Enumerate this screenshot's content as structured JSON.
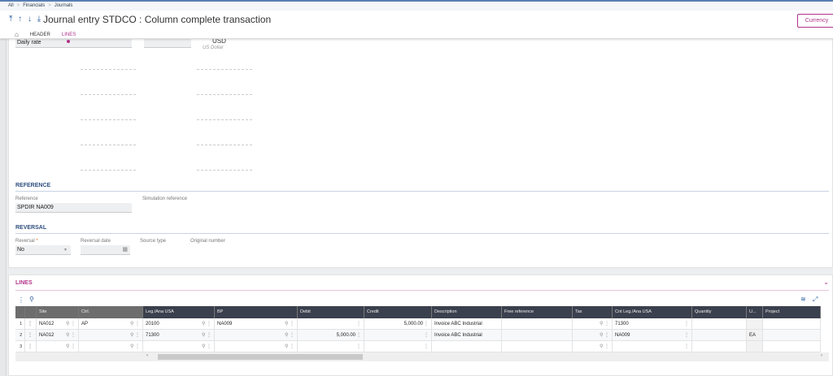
{
  "breadcrumb": [
    "All",
    "Financials",
    "Journals"
  ],
  "header": {
    "title": "Journal entry STDCO : Column complete transaction",
    "nav_icons": "⤒ ↑ ↓ ⤓",
    "tabs": [
      "HEADER",
      "LINES"
    ],
    "active_tab": "LINES",
    "currency_button": "Currency"
  },
  "partial_fields": {
    "rate_type": "Daily rate",
    "currency": "USD",
    "currency_name": "US Dollar"
  },
  "reference": {
    "section": "REFERENCE",
    "reference_label": "Reference",
    "reference_value": "SPDIR NA009",
    "simulation_label": "Simulation reference"
  },
  "reversal": {
    "section": "REVERSAL",
    "reversal_label": "Reversal",
    "reversal_value": "No",
    "reversal_date_label": "Reversal date",
    "source_type_label": "Source type",
    "original_number_label": "Original number"
  },
  "lines": {
    "title": "LINES",
    "columns": [
      "Site",
      "Ctrl.",
      "Leg./Ana USA",
      "BP",
      "Debit",
      "Credit",
      "Description",
      "Free reference",
      "Tax",
      "Cnt Leg./Ana USA",
      "Quantity",
      "U...",
      "Project"
    ],
    "rows": [
      [
        "1",
        "NA012",
        "AP",
        "20100",
        "NA009",
        "",
        "5,000.00",
        "Invoice ABC Industrial",
        "",
        "",
        "71300",
        "",
        "",
        ""
      ],
      [
        "2",
        "NA012",
        "",
        "71300",
        "",
        "5,000.00",
        "",
        "Invoice ABC Industrial",
        "",
        "",
        "NA009",
        "",
        "EA",
        ""
      ],
      [
        "3",
        "",
        "",
        "",
        "",
        "",
        "",
        "",
        "",
        "",
        "",
        "",
        "",
        ""
      ]
    ]
  },
  "colors": {
    "accent": "#b0338a",
    "header_dark": "#3a404d",
    "section_blue": "#2f4f7f"
  }
}
